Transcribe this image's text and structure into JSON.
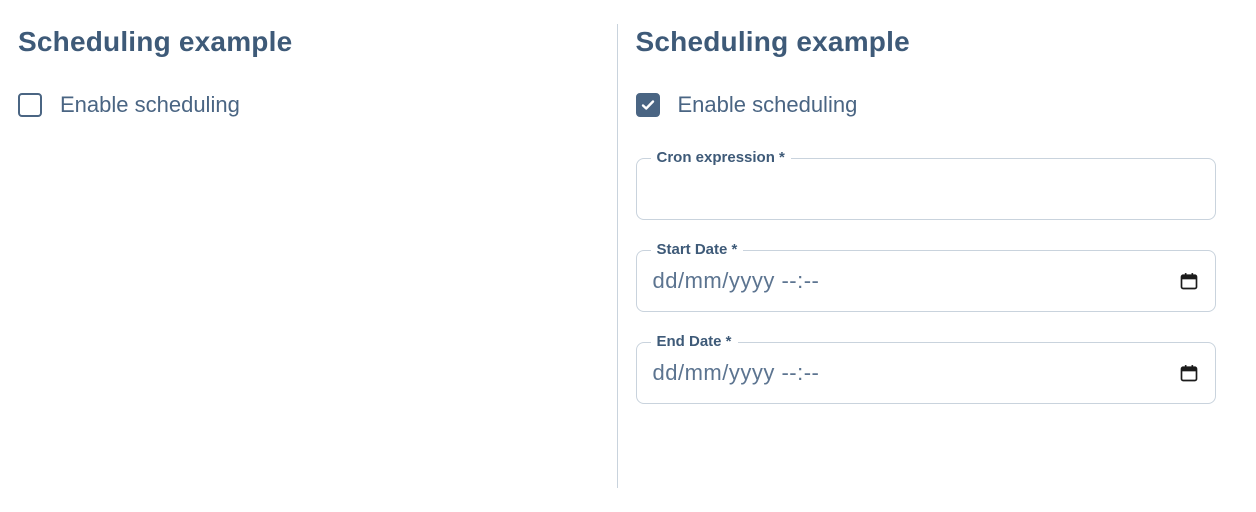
{
  "left": {
    "title": "Scheduling example",
    "enable_label": "Enable scheduling",
    "enabled": false
  },
  "right": {
    "title": "Scheduling example",
    "enable_label": "Enable scheduling",
    "enabled": true,
    "fields": {
      "cron": {
        "label": "Cron expression *",
        "value": ""
      },
      "start": {
        "label": "Start Date *",
        "placeholder": "dd/mm/yyyy --:--",
        "value": ""
      },
      "end": {
        "label": "End Date *",
        "placeholder": "dd/mm/yyyy --:--",
        "value": ""
      }
    }
  }
}
